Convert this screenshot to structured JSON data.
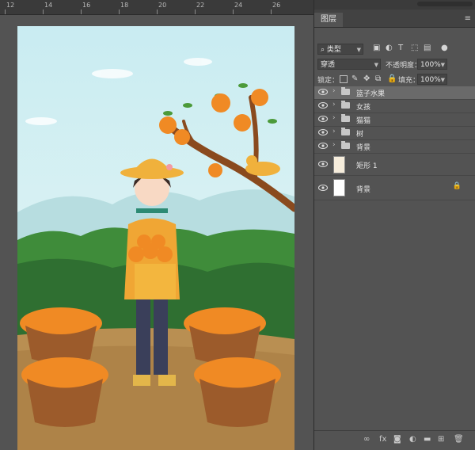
{
  "ruler": {
    "ticks": [
      "12",
      "14",
      "16",
      "18",
      "20",
      "22",
      "24",
      "26"
    ]
  },
  "panel": {
    "tab": "图层",
    "menu": "≡",
    "filter": {
      "label": "类型"
    },
    "blend_mode": "穿透",
    "opacity_label": "不透明度：",
    "opacity_value": "100%",
    "lock_label": "锁定：",
    "fill_label": "填充：",
    "fill_value": "100%"
  },
  "layers": [
    {
      "name": "篮子水果",
      "type": "group",
      "selected": true
    },
    {
      "name": "女孩",
      "type": "group"
    },
    {
      "name": "猫猫",
      "type": "group"
    },
    {
      "name": "树",
      "type": "group"
    },
    {
      "name": "背景",
      "type": "group"
    },
    {
      "name": "矩形 1",
      "type": "shape"
    },
    {
      "name": "背景",
      "type": "background",
      "locked": true
    }
  ],
  "colors": {
    "panel": "#535353",
    "selected": "#6a6a6a",
    "orange": "#f08a24"
  }
}
